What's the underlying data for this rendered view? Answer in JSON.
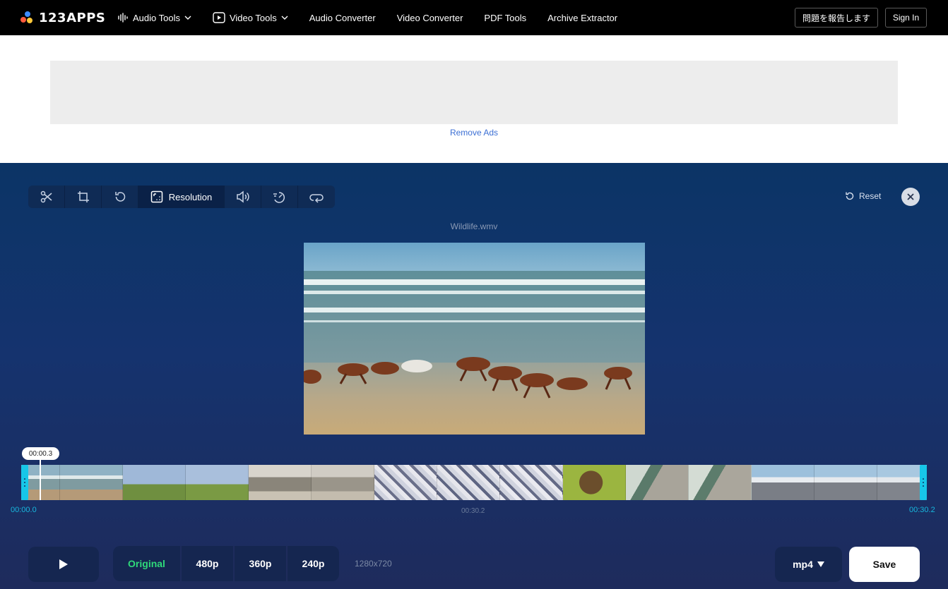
{
  "brand": {
    "logo_text": "123APPS"
  },
  "nav": {
    "items": [
      {
        "label": "Audio Tools",
        "icon": "audio-wave-icon",
        "dropdown": true
      },
      {
        "label": "Video Tools",
        "icon": "play-square-icon",
        "dropdown": true
      },
      {
        "label": "Audio Converter"
      },
      {
        "label": "Video Converter"
      },
      {
        "label": "PDF Tools"
      },
      {
        "label": "Archive Extractor"
      }
    ],
    "report_label": "問題を報告します",
    "signin_label": "Sign In"
  },
  "ads": {
    "remove_label": "Remove Ads"
  },
  "editor": {
    "tools": [
      {
        "name": "cut",
        "icon": "scissors-icon"
      },
      {
        "name": "crop",
        "icon": "crop-icon"
      },
      {
        "name": "rotate",
        "icon": "rotate-icon"
      },
      {
        "name": "resolution",
        "icon": "resolution-icon",
        "label": "Resolution",
        "active": true
      },
      {
        "name": "volume",
        "icon": "volume-icon"
      },
      {
        "name": "speed",
        "icon": "speed-icon"
      },
      {
        "name": "loop",
        "icon": "loop-icon"
      }
    ],
    "reset_label": "Reset",
    "filename": "Wildlife.wmv",
    "timeline": {
      "cursor_time": "00:00.3",
      "start_time": "00:00.0",
      "mid_time": "00:30.2",
      "end_time": "00:30.2"
    },
    "resolution_options": [
      "Original",
      "480p",
      "360p",
      "240p"
    ],
    "selected_resolution": "Original",
    "resolution_dims": "1280x720",
    "format": "mp4",
    "save_label": "Save"
  },
  "colors": {
    "accent_cyan": "#17c6e8",
    "selected_green": "#2fd97a",
    "link_blue": "#3b6fd4"
  }
}
